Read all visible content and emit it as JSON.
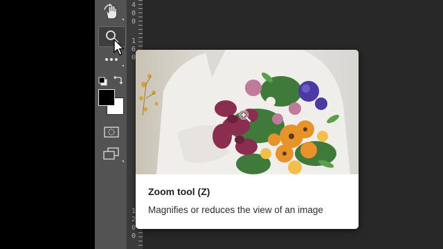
{
  "ruler": {
    "top_digits": [
      "4",
      "0",
      "0"
    ],
    "mid_digits": [
      "1",
      "6",
      "0"
    ],
    "bottom_digits": [
      "1",
      "2",
      "0",
      "0"
    ]
  },
  "toolbar": {
    "tools": [
      {
        "name": "rotate-view-tool",
        "icon": "hand-rotate-icon"
      },
      {
        "name": "zoom-tool",
        "icon": "magnifier-icon",
        "active": true
      },
      {
        "name": "more-tools",
        "icon": "ellipsis-icon"
      },
      {
        "name": "default-colors",
        "icon": "default-colors-icon"
      },
      {
        "name": "swap-colors",
        "icon": "swap-arrow-icon"
      },
      {
        "name": "foreground-color",
        "color": "#000000"
      },
      {
        "name": "background-color",
        "color": "#ffffff"
      },
      {
        "name": "quick-mask",
        "icon": "quick-mask-icon"
      },
      {
        "name": "screen-mode",
        "icon": "screen-mode-icon"
      }
    ]
  },
  "tooltip": {
    "title": "Zoom tool (Z)",
    "description": "Magnifies or reduces the view of an image"
  },
  "colors": {
    "toolbar_bg": "#535353",
    "canvas_bg": "#282828",
    "tooltip_bg": "#ffffff"
  }
}
